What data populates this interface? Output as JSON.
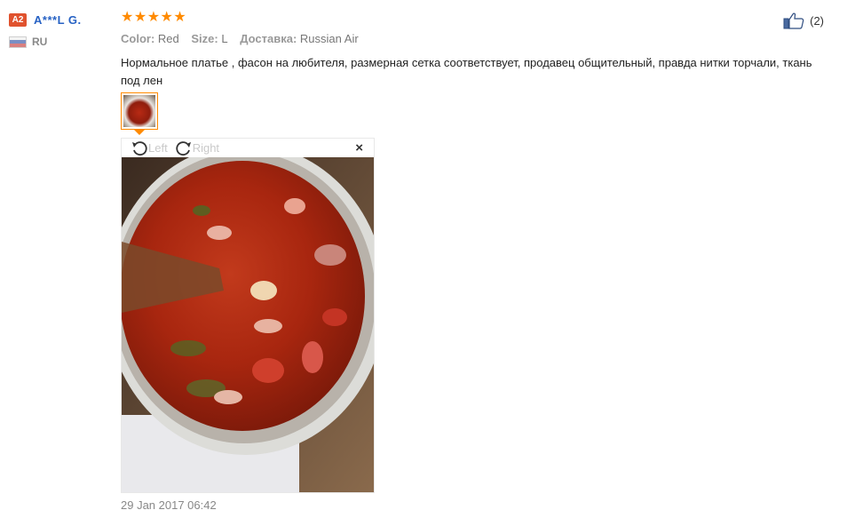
{
  "user": {
    "level_badge": "A2",
    "name": "A***L G.",
    "country": "RU"
  },
  "review": {
    "stars": [
      "★",
      "★",
      "★",
      "★",
      "★"
    ],
    "rating": 5,
    "color_label": "Color:",
    "color_value": "Red",
    "size_label": "Size:",
    "size_value": "L",
    "delivery_label": "Доставка:",
    "delivery_value": "Russian Air",
    "text": "Нормальное платье , фасон на любителя, размерная сетка соответствует, продавец общительный, правда нитки торчали, ткань под лен",
    "helpful_count": "(2)",
    "date": "29 Jan 2017 06:42"
  },
  "viewer": {
    "rotate_left": "Left",
    "rotate_right": "Right",
    "close": "×"
  },
  "colors": {
    "accent": "#ff8a00",
    "username": "#2762c4",
    "badge": "#e0522e"
  }
}
